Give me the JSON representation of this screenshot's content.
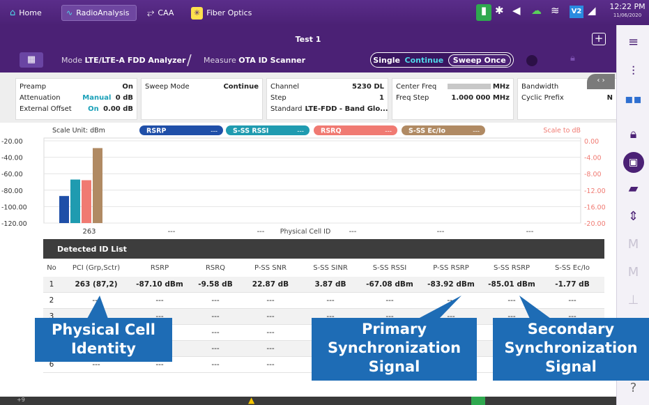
{
  "tabs": {
    "home": "Home",
    "radio": "RadioAnalysis",
    "caa": "CAA",
    "fiber": "Fiber Optics"
  },
  "clock": {
    "time": "12:22 PM",
    "date": "11/06/2020"
  },
  "status_icons": {
    "battery": "battery-charging-icon",
    "bluetooth": "bluetooth-icon",
    "speaker": "speaker-icon",
    "cloud": "cloud-check-icon",
    "wifi": "wifi-icon",
    "v2": "V2",
    "signal": "signal-bars-icon"
  },
  "title": {
    "test": "Test 1",
    "plus": "+"
  },
  "mode": {
    "label": "Mode",
    "value": "LTE/LTE-A FDD Analyzer"
  },
  "measure": {
    "label": "Measure",
    "value": "OTA ID Scanner"
  },
  "run": {
    "single": "Single",
    "continue": "Continue",
    "sweep_once": "Sweep Once"
  },
  "params": {
    "preamp_label": "Preamp",
    "preamp_value": "On",
    "atten_label": "Attenuation",
    "atten_mode": "Manual",
    "atten_value": "0 dB",
    "extoff_label": "External Offset",
    "extoff_mode": "On",
    "extoff_value": "0.00 dB",
    "sweep_label": "Sweep Mode",
    "sweep_value": "Continue",
    "channel_label": "Channel",
    "channel_value": "5230 DL",
    "step_label": "Step",
    "step_value": "1",
    "standard_label": "Standard",
    "standard_value": "LTE-FDD - Band Glo...",
    "cf_label": "Center Freq",
    "cf_unit": "MHz",
    "fstep_label": "Freq Step",
    "fstep_value": "1.000 000 MHz",
    "bw_label": "Bandwidth",
    "bw_value": "10",
    "cp_label": "Cyclic Prefix",
    "cp_value": "N"
  },
  "chart_data": {
    "type": "bar",
    "scale_unit": "Scale Unit: dBm",
    "scale_right": "Scale to dB",
    "legend": [
      {
        "name": "RSRP",
        "value": "---",
        "color": "#1f4fa8"
      },
      {
        "name": "S-SS RSSI",
        "value": "---",
        "color": "#1f9bb0"
      },
      {
        "name": "RSRQ",
        "value": "---",
        "color": "#f07a72"
      },
      {
        "name": "S-SS Ec/Io",
        "value": "---",
        "color": "#b08a63"
      }
    ],
    "yticks_left": [
      "-20.00",
      "-40.00",
      "-60.00",
      "-80.00",
      "-100.00",
      "-120.00"
    ],
    "yticks_right": [
      "0.00",
      "-4.00",
      "-8.00",
      "-12.00",
      "-16.00",
      "-20.00"
    ],
    "ylim": [
      -120,
      -20
    ],
    "ylim_right": [
      -20,
      0
    ],
    "xlabel": "Physical Cell ID",
    "categories": [
      "263",
      "---",
      "---",
      "---",
      "---",
      "---"
    ],
    "bars": [
      {
        "series": "RSRP",
        "value": -87.1,
        "axis": "left"
      },
      {
        "series": "S-SS RSSI",
        "value": -67.08,
        "axis": "left"
      },
      {
        "series": "RSRQ",
        "value": -9.58,
        "axis": "right"
      },
      {
        "series": "S-SS Ec/Io",
        "value": -1.77,
        "axis": "right"
      }
    ]
  },
  "detected": {
    "title": "Detected ID List",
    "columns": [
      "No",
      "PCI (Grp,Sctr)",
      "RSRP",
      "RSRQ",
      "P-SS SNR",
      "S-SS SINR",
      "S-SS RSSI",
      "P-SS RSRP",
      "S-SS RSRP",
      "S-SS Ec/Io"
    ],
    "rows": [
      [
        "1",
        "263 (87,2)",
        "-87.10 dBm",
        "-9.58 dB",
        "22.87 dB",
        "3.87 dB",
        "-67.08 dBm",
        "-83.92 dBm",
        "-85.01 dBm",
        "-1.77 dB"
      ],
      [
        "2",
        "---",
        "---",
        "---",
        "---",
        "---",
        "---",
        "---",
        "---",
        "---"
      ],
      [
        "3",
        "---",
        "---",
        "---",
        "---",
        "---",
        "---",
        "---",
        "---",
        "---"
      ],
      [
        "4",
        "---",
        "---",
        "---",
        "---",
        "---",
        "---",
        "---",
        "---",
        "---"
      ],
      [
        "5",
        "---",
        "---",
        "---",
        "---",
        "---",
        "---",
        "---",
        "---",
        "---"
      ],
      [
        "6",
        "---",
        "---",
        "---",
        "---",
        "---",
        "---",
        "---",
        "---",
        "---"
      ]
    ]
  },
  "callouts": {
    "pci": [
      "Physical Cell",
      "Identity"
    ],
    "pss": [
      "Primary",
      "Synchronization",
      "Signal"
    ],
    "sss": [
      "Secondary",
      "Synchronization",
      "Signal"
    ]
  },
  "statusbar": {
    "left": "+9"
  },
  "sidebar": [
    "menu-icon",
    "sliders-icon",
    "display-mode-icon",
    "lock-icon",
    "save-icon",
    "folder-open-icon",
    "split-view-icon",
    "marker-icon",
    "marker-table-icon",
    "trace-icon",
    "help-icon"
  ]
}
